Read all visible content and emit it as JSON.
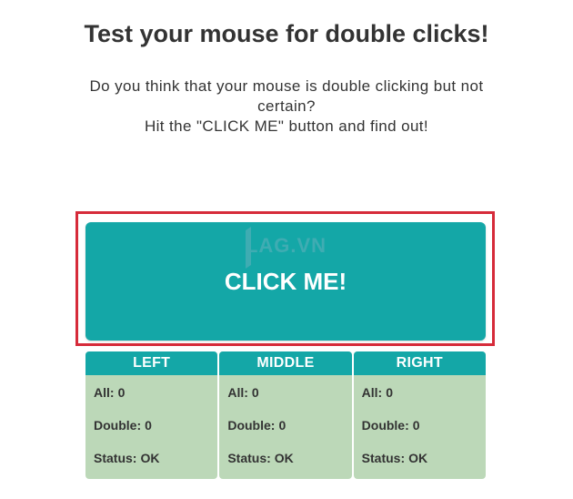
{
  "header": {
    "title": "Test your mouse for double clicks!",
    "line1": "Do you think that your mouse is double clicking but not",
    "line2": "certain?",
    "line3": "Hit the \"CLICK ME\" button and find out!"
  },
  "button": {
    "label": "CLICK ME!"
  },
  "watermark": {
    "text": "LAG.VN"
  },
  "columns": [
    {
      "header": "LEFT",
      "all_label": "All:",
      "all": "0",
      "double_label": "Double:",
      "double": "0",
      "status_label": "Status:",
      "status": "OK"
    },
    {
      "header": "MIDDLE",
      "all_label": "All:",
      "all": "0",
      "double_label": "Double:",
      "double": "0",
      "status_label": "Status:",
      "status": "OK"
    },
    {
      "header": "RIGHT",
      "all_label": "All:",
      "all": "0",
      "double_label": "Double:",
      "double": "0",
      "status_label": "Status:",
      "status": "OK"
    }
  ],
  "colors": {
    "accent": "#14a7a7",
    "panel": "#bcd8b8",
    "highlight_border": "#d62b3a",
    "text": "#333333"
  }
}
